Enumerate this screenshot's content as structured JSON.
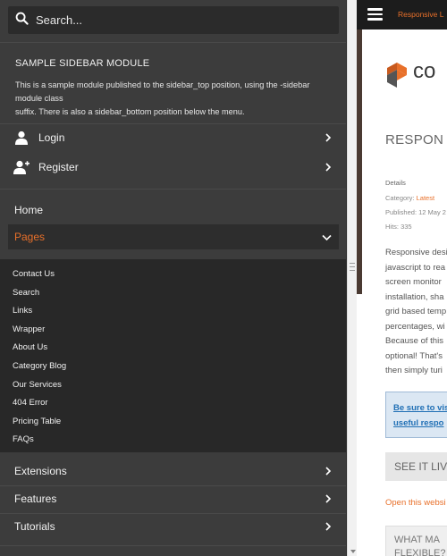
{
  "search": {
    "placeholder": "Search..."
  },
  "module": {
    "title": "SAMPLE SIDEBAR MODULE",
    "text_line1": "This is a sample module published to the sidebar_top position, using the -sidebar module class",
    "text_line2": "suffix. There is also a sidebar_bottom position below the menu."
  },
  "account": {
    "login": "Login",
    "register": "Register"
  },
  "menu": {
    "home": "Home",
    "pages": "Pages",
    "pages_items": [
      "Contact Us",
      "Search",
      "Links",
      "Wrapper",
      "About Us",
      "Category Blog",
      "Our Services",
      "404 Error",
      "Pricing Table",
      "FAQs"
    ],
    "extensions": "Extensions",
    "features": "Features",
    "tutorials": "Tutorials"
  },
  "main": {
    "topbar_tab": "Responsive L",
    "logo_text": "co",
    "article_title": "RESPON",
    "details_label": "Details",
    "category_label": "Category: ",
    "category_value": "Latest",
    "published": "Published: 12 May 2",
    "hits": "Hits: 335",
    "body_lines": [
      "Responsive desi",
      "javascript to rea",
      "screen monitor",
      "installation, sha",
      "grid based temp",
      "percentages, wi",
      "Because of this",
      "optional! That's",
      "then simply turi"
    ],
    "info_line1": "Be sure to vis",
    "info_line2": "useful respo",
    "see_button": "SEE IT LIV",
    "open_link": "Open this websi",
    "what_line1": "WHAT MA",
    "what_line2": "FLEXIBLE?"
  },
  "colors": {
    "accent": "#e8702a",
    "sidebar_bg": "#3c3c3c",
    "submenu_bg": "#282828"
  },
  "icons": [
    "search-icon",
    "user-icon",
    "user-add-icon",
    "chevron-right-icon",
    "chevron-down-icon",
    "hamburger-icon"
  ]
}
